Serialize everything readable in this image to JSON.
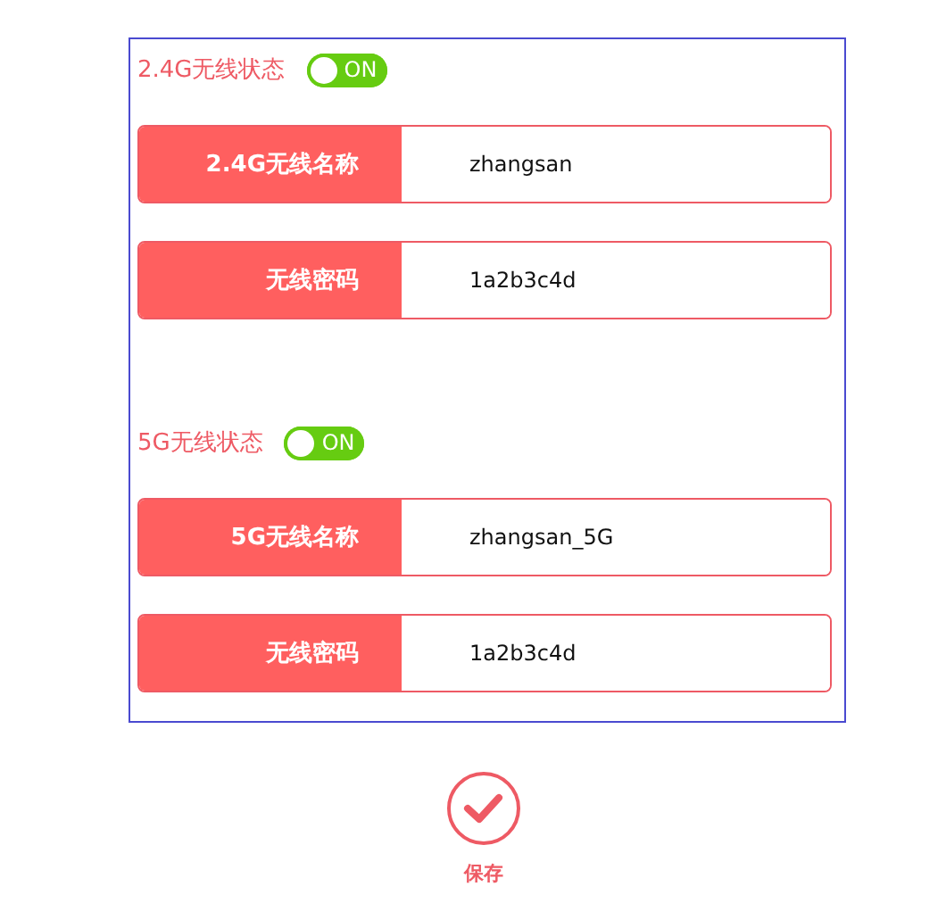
{
  "sections": [
    {
      "status_label": "2.4G无线状态",
      "toggle": {
        "on": true,
        "text": "ON"
      },
      "fields": [
        {
          "label": "2.4G无线名称",
          "value": "zhangsan"
        },
        {
          "label": "无线密码",
          "value": "1a2b3c4d"
        }
      ]
    },
    {
      "status_label": "5G无线状态",
      "toggle": {
        "on": true,
        "text": "ON"
      },
      "fields": [
        {
          "label": "5G无线名称",
          "value": "zhangsan_5G"
        },
        {
          "label": "无线密码",
          "value": "1a2b3c4d"
        }
      ]
    }
  ],
  "save": {
    "label": "保存"
  }
}
